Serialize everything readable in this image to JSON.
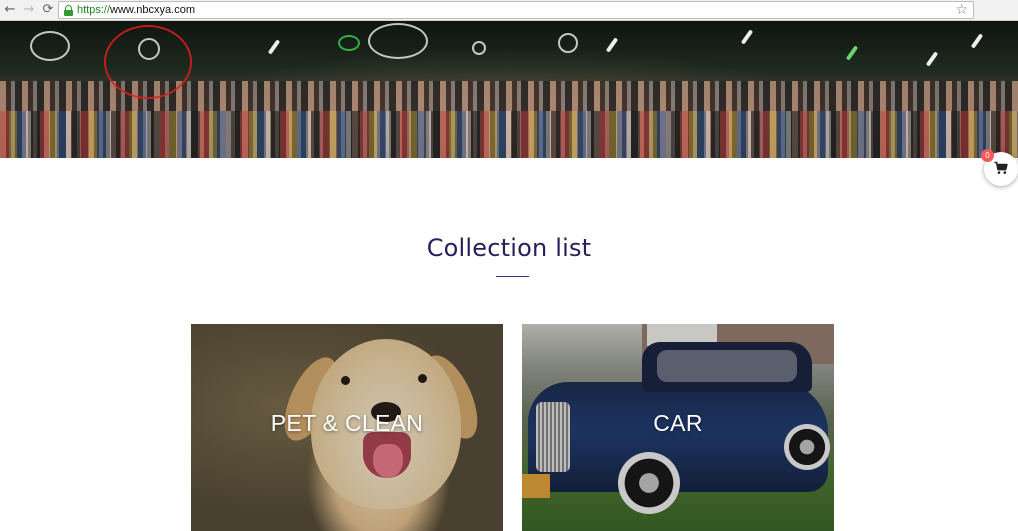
{
  "browser": {
    "url_scheme": "https://",
    "url_host": "www.nbcxya.com",
    "back_glyph": "←",
    "forward_glyph": "→",
    "reload_glyph": "⟳",
    "star_glyph": "☆"
  },
  "cart": {
    "count": "0",
    "icon": "shopping-cart-icon"
  },
  "section": {
    "title": "Collection list"
  },
  "collections": [
    {
      "label": "PET & CLEAN"
    },
    {
      "label": "CAR"
    }
  ],
  "colors": {
    "title": "#2a1d5e",
    "cart_badge": "#f25a5a",
    "secure_scheme": "#1e8a1e"
  }
}
